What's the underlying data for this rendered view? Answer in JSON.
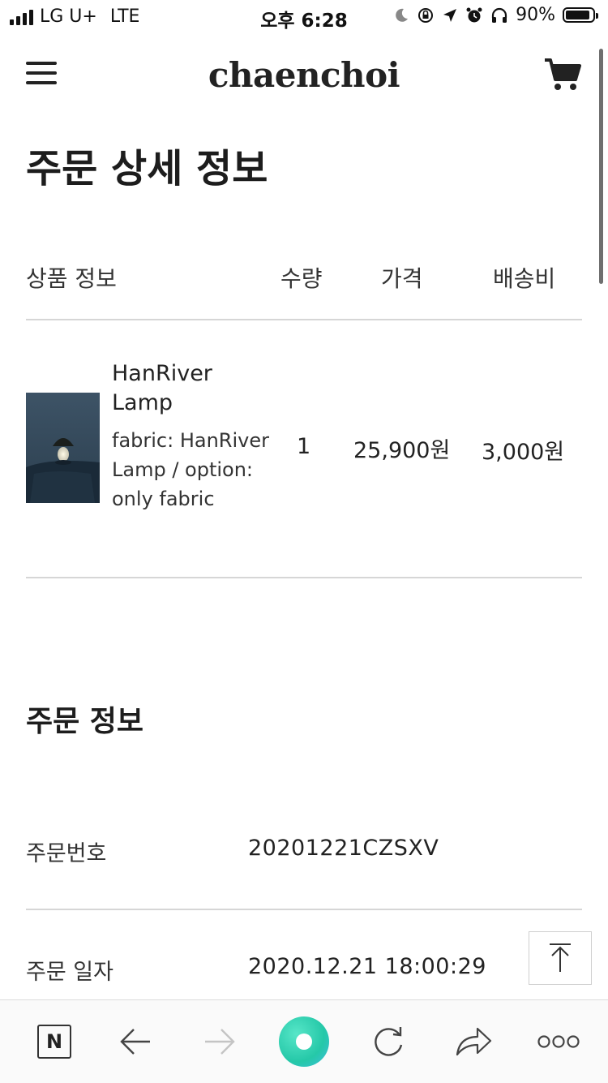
{
  "status_bar": {
    "carrier": "LG U+",
    "network": "LTE",
    "time": "오후 6:28",
    "battery_percent": "90%",
    "battery_level": 0.9
  },
  "header": {
    "logo": "chaenchoi",
    "menu_icon": "hamburger-menu-icon",
    "cart_icon": "cart-icon"
  },
  "page": {
    "title": "주문 상세 정보"
  },
  "table": {
    "headers": {
      "product": "상품 정보",
      "quantity": "수량",
      "price": "가격",
      "shipping": "배송비"
    },
    "items": [
      {
        "name": "HanRiver Lamp",
        "option": "fabric: HanRiver Lamp / option: only fabric",
        "quantity": "1",
        "price": "25,900원",
        "shipping": "3,000원"
      }
    ]
  },
  "order_info": {
    "title": "주문 정보",
    "rows": [
      {
        "label": "주문번호",
        "value": "20201221CZSXV"
      },
      {
        "label": "주문 일자",
        "value": "2020.12.21 18:00:29"
      }
    ]
  },
  "toolbar": {
    "n_label": "N",
    "icons": [
      "naver-n-icon",
      "back-arrow-icon",
      "forward-arrow-icon",
      "green-dot-icon",
      "reload-icon",
      "share-icon",
      "more-icon"
    ]
  },
  "colors": {
    "text": "#222222",
    "divider": "#d6d6d6",
    "green_button": "#2ccfb0"
  }
}
